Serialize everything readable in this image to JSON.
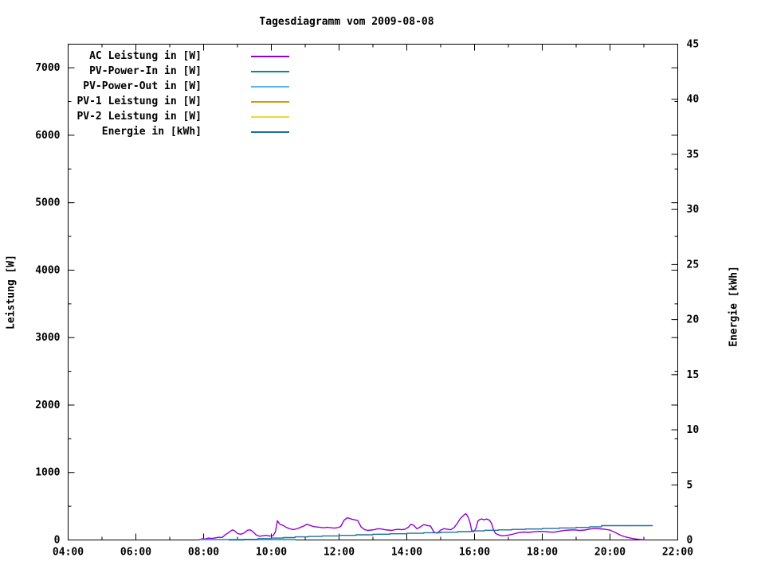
{
  "window": {
    "background": "#ffffff",
    "foreground": "#000000"
  },
  "chart_data": {
    "type": "line",
    "title": "Tagesdiagramm vom 2009-08-08",
    "xlabel": "",
    "ylabel_left": "Leistung [W]",
    "ylabel_right": "Energie [kWh]",
    "x_range_hours": [
      4,
      22
    ],
    "x_tick_labels": [
      "04:00",
      "06:00",
      "08:00",
      "10:00",
      "12:00",
      "14:00",
      "16:00",
      "18:00",
      "20:00",
      "22:00"
    ],
    "x_minor_step_hours": 1,
    "y_left_range": [
      0,
      7350
    ],
    "y_left_ticks": [
      0,
      1000,
      2000,
      3000,
      4000,
      5000,
      6000,
      7000
    ],
    "y_left_minor_step": 500,
    "y_right_range": [
      0,
      45
    ],
    "y_right_ticks": [
      0,
      5,
      10,
      15,
      20,
      25,
      30,
      35,
      40,
      45
    ],
    "grid": false,
    "legend_position": "top-left-inside",
    "series": [
      {
        "name": "AC Leistung in [W]",
        "slug": "ac-leistung",
        "color": "#9400d3",
        "axis": "left",
        "style": "line",
        "points": [
          [
            7.85,
            0
          ],
          [
            7.95,
            18
          ],
          [
            8.05,
            15
          ],
          [
            8.15,
            28
          ],
          [
            8.25,
            22
          ],
          [
            8.35,
            32
          ],
          [
            8.45,
            40
          ],
          [
            8.55,
            38
          ],
          [
            8.65,
            80
          ],
          [
            8.75,
            115
          ],
          [
            8.85,
            150
          ],
          [
            8.92,
            135
          ],
          [
            9.0,
            95
          ],
          [
            9.1,
            85
          ],
          [
            9.2,
            105
          ],
          [
            9.3,
            145
          ],
          [
            9.38,
            150
          ],
          [
            9.45,
            125
          ],
          [
            9.55,
            75
          ],
          [
            9.65,
            55
          ],
          [
            9.75,
            62
          ],
          [
            9.85,
            68
          ],
          [
            9.95,
            58
          ],
          [
            10.05,
            62
          ],
          [
            10.12,
            120
          ],
          [
            10.18,
            285
          ],
          [
            10.25,
            235
          ],
          [
            10.35,
            215
          ],
          [
            10.45,
            185
          ],
          [
            10.55,
            165
          ],
          [
            10.65,
            155
          ],
          [
            10.75,
            165
          ],
          [
            10.85,
            185
          ],
          [
            10.95,
            205
          ],
          [
            11.05,
            232
          ],
          [
            11.15,
            215
          ],
          [
            11.25,
            198
          ],
          [
            11.35,
            192
          ],
          [
            11.45,
            186
          ],
          [
            11.55,
            180
          ],
          [
            11.65,
            188
          ],
          [
            11.75,
            182
          ],
          [
            11.85,
            176
          ],
          [
            11.95,
            182
          ],
          [
            12.05,
            200
          ],
          [
            12.15,
            295
          ],
          [
            12.25,
            330
          ],
          [
            12.35,
            312
          ],
          [
            12.45,
            300
          ],
          [
            12.55,
            288
          ],
          [
            12.65,
            195
          ],
          [
            12.75,
            155
          ],
          [
            12.85,
            142
          ],
          [
            12.95,
            148
          ],
          [
            13.05,
            155
          ],
          [
            13.15,
            168
          ],
          [
            13.25,
            163
          ],
          [
            13.35,
            152
          ],
          [
            13.45,
            148
          ],
          [
            13.55,
            142
          ],
          [
            13.65,
            152
          ],
          [
            13.75,
            158
          ],
          [
            13.85,
            152
          ],
          [
            13.95,
            160
          ],
          [
            14.05,
            190
          ],
          [
            14.12,
            232
          ],
          [
            14.2,
            218
          ],
          [
            14.3,
            165
          ],
          [
            14.4,
            195
          ],
          [
            14.5,
            228
          ],
          [
            14.6,
            215
          ],
          [
            14.7,
            205
          ],
          [
            14.8,
            118
          ],
          [
            14.9,
            102
          ],
          [
            15.0,
            148
          ],
          [
            15.1,
            168
          ],
          [
            15.2,
            158
          ],
          [
            15.3,
            152
          ],
          [
            15.4,
            185
          ],
          [
            15.5,
            255
          ],
          [
            15.58,
            318
          ],
          [
            15.66,
            358
          ],
          [
            15.74,
            390
          ],
          [
            15.78,
            368
          ],
          [
            15.82,
            328
          ],
          [
            15.87,
            248
          ],
          [
            15.91,
            152
          ],
          [
            15.95,
            122
          ],
          [
            16.0,
            135
          ],
          [
            16.05,
            185
          ],
          [
            16.1,
            282
          ],
          [
            16.15,
            302
          ],
          [
            16.2,
            312
          ],
          [
            16.28,
            300
          ],
          [
            16.36,
            310
          ],
          [
            16.44,
            292
          ],
          [
            16.5,
            248
          ],
          [
            16.56,
            150
          ],
          [
            16.62,
            95
          ],
          [
            16.7,
            78
          ],
          [
            16.8,
            62
          ],
          [
            16.9,
            66
          ],
          [
            17.0,
            72
          ],
          [
            17.15,
            88
          ],
          [
            17.3,
            108
          ],
          [
            17.45,
            118
          ],
          [
            17.6,
            112
          ],
          [
            17.75,
            122
          ],
          [
            17.9,
            128
          ],
          [
            18.05,
            126
          ],
          [
            18.2,
            118
          ],
          [
            18.35,
            116
          ],
          [
            18.5,
            130
          ],
          [
            18.65,
            140
          ],
          [
            18.8,
            148
          ],
          [
            18.95,
            150
          ],
          [
            19.1,
            142
          ],
          [
            19.25,
            148
          ],
          [
            19.4,
            162
          ],
          [
            19.55,
            170
          ],
          [
            19.7,
            165
          ],
          [
            19.85,
            158
          ],
          [
            20.0,
            146
          ],
          [
            20.15,
            112
          ],
          [
            20.3,
            72
          ],
          [
            20.45,
            46
          ],
          [
            20.6,
            28
          ],
          [
            20.75,
            15
          ],
          [
            20.9,
            7
          ],
          [
            21.05,
            0
          ]
        ]
      },
      {
        "name": "PV-Power-In in [W]",
        "slug": "pv-power-in",
        "color": "#008f8f",
        "axis": "left",
        "style": "line",
        "points": [
          [
            7.9,
            8
          ],
          [
            10.7,
            8
          ]
        ]
      },
      {
        "name": "PV-Power-Out in [W]",
        "slug": "pv-power-out",
        "color": "#5ab4e5",
        "axis": "left",
        "style": "line",
        "points": [
          [
            7.9,
            4
          ],
          [
            10.7,
            4
          ]
        ]
      },
      {
        "name": "PV-1 Leistung in [W]",
        "slug": "pv-1-leistung",
        "color": "#d99800",
        "axis": "left",
        "style": "line",
        "points": []
      },
      {
        "name": "PV-2 Leistung in [W]",
        "slug": "pv-2-leistung",
        "color": "#ead93d",
        "axis": "left",
        "style": "line",
        "points": []
      },
      {
        "name": "Energie in [kWh]",
        "slug": "energie",
        "color": "#1c6fa5",
        "axis": "right",
        "style": "step",
        "points": [
          [
            8.75,
            0
          ],
          [
            9.2,
            0.06
          ],
          [
            9.6,
            0.12
          ],
          [
            10.0,
            0.17
          ],
          [
            10.35,
            0.22
          ],
          [
            10.7,
            0.28
          ],
          [
            11.1,
            0.32
          ],
          [
            11.5,
            0.37
          ],
          [
            12.0,
            0.42
          ],
          [
            12.5,
            0.47
          ],
          [
            13.0,
            0.52
          ],
          [
            13.5,
            0.56
          ],
          [
            14.0,
            0.61
          ],
          [
            14.5,
            0.66
          ],
          [
            15.0,
            0.7
          ],
          [
            15.5,
            0.76
          ],
          [
            15.9,
            0.82
          ],
          [
            16.3,
            0.88
          ],
          [
            16.7,
            0.92
          ],
          [
            17.1,
            0.96
          ],
          [
            17.5,
            1.0
          ],
          [
            18.0,
            1.04
          ],
          [
            18.5,
            1.09
          ],
          [
            19.0,
            1.14
          ],
          [
            19.4,
            1.2
          ],
          [
            19.75,
            1.3
          ],
          [
            21.25,
            1.3
          ]
        ]
      }
    ]
  }
}
